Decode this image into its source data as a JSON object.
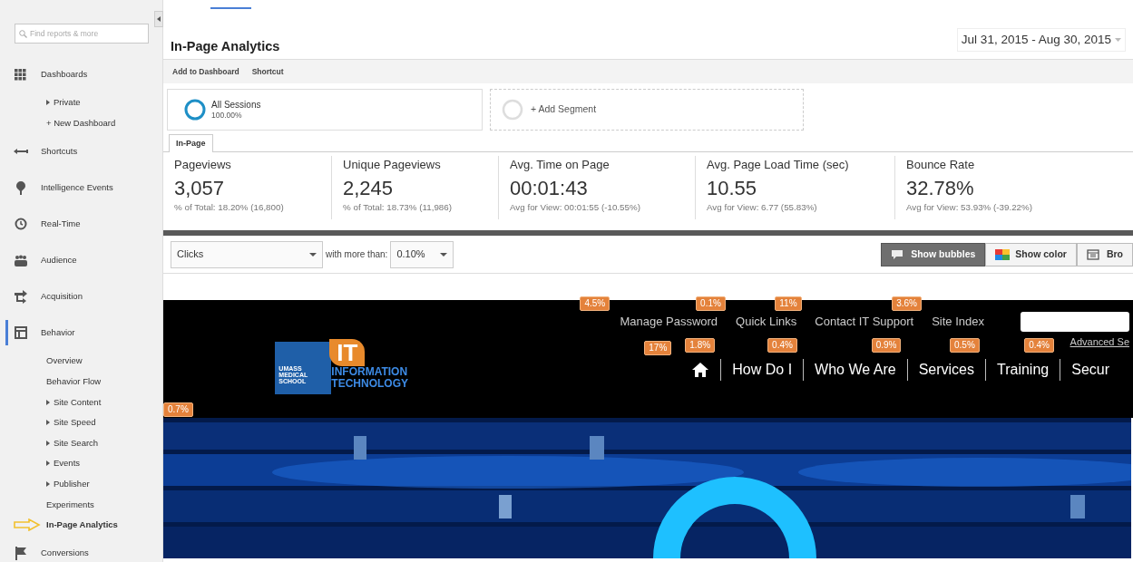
{
  "sidebar": {
    "search": {
      "placeholder": "Find reports & more"
    },
    "items": [
      {
        "label": "Dashboards",
        "selected": false,
        "children": [
          {
            "label": "Private",
            "expandable": true,
            "selected": false
          },
          {
            "label": "+ New Dashboard",
            "expandable": false,
            "selected": false
          }
        ]
      },
      {
        "label": "Shortcuts",
        "selected": false
      },
      {
        "label": "Intelligence Events",
        "selected": false
      },
      {
        "label": "Real-Time",
        "selected": false
      },
      {
        "label": "Audience",
        "selected": false
      },
      {
        "label": "Acquisition",
        "selected": false
      },
      {
        "label": "Behavior",
        "selected": true,
        "children": [
          {
            "label": "Overview",
            "expandable": false,
            "selected": false
          },
          {
            "label": "Behavior Flow",
            "expandable": false,
            "selected": false
          },
          {
            "label": "Site Content",
            "expandable": true,
            "selected": false
          },
          {
            "label": "Site Speed",
            "expandable": true,
            "selected": false
          },
          {
            "label": "Site Search",
            "expandable": true,
            "selected": false
          },
          {
            "label": "Events",
            "expandable": true,
            "selected": false
          },
          {
            "label": "Publisher",
            "expandable": true,
            "selected": false
          },
          {
            "label": "Experiments",
            "expandable": false,
            "selected": false
          },
          {
            "label": "In-Page Analytics",
            "expandable": false,
            "selected": true
          }
        ]
      },
      {
        "label": "Conversions",
        "selected": false
      }
    ]
  },
  "header": {
    "title": "In-Page Analytics",
    "date_range": "Jul 31, 2015 - Aug 30, 2015",
    "actions": [
      "Add to Dashboard",
      "Shortcut"
    ]
  },
  "segments": [
    {
      "label": "All Sessions",
      "sub": "100.00%"
    }
  ],
  "add_segment": "+ Add Segment",
  "tabs": [
    {
      "label": "In-Page",
      "selected": true
    }
  ],
  "metrics": [
    {
      "label": "Pageviews",
      "value": "3,057",
      "sub": "% of Total: 18.20% (16,800)"
    },
    {
      "label": "Unique Pageviews",
      "value": "2,245",
      "sub": "% of Total: 18.73% (11,986)"
    },
    {
      "label": "Avg. Time on Page",
      "value": "00:01:43",
      "sub": "Avg for View: 00:01:55 (-10.55%)"
    },
    {
      "label": "Avg. Page Load Time (sec)",
      "value": "10.55",
      "sub": "Avg for View: 6.77 (55.83%)"
    },
    {
      "label": "Bounce Rate",
      "value": "32.78%",
      "sub": "Avg for View: 53.93% (-39.22%)"
    }
  ],
  "controls": {
    "metric": "Clicks",
    "threshold_label": "with more than:",
    "threshold": "0.10%",
    "buttons": [
      {
        "label": "Show bubbles",
        "selected": true
      },
      {
        "label": "Show color",
        "selected": false
      },
      {
        "label": "Bro",
        "selected": false
      }
    ]
  },
  "site": {
    "top_links": [
      {
        "label": "Manage Password",
        "pct": "4.5%"
      },
      {
        "label": "Quick Links",
        "pct": "0.1%"
      },
      {
        "label": "Contact IT Support",
        "pct": "11%"
      },
      {
        "label": "Site Index",
        "pct": "3.6%"
      }
    ],
    "advanced_search": "Advanced Se",
    "logo": {
      "badge": "IT",
      "line1": "INFORMATION",
      "line2": "TECHNOLOGY",
      "school": [
        "UMASS",
        "MEDICAL",
        "SCHOOL"
      ]
    },
    "nav": [
      {
        "kind": "home",
        "pct": "17%"
      },
      {
        "kind": "text",
        "label": "How Do I",
        "pct": "1.8%"
      },
      {
        "kind": "text",
        "label": "Who We Are",
        "pct": "0.4%"
      },
      {
        "kind": "text",
        "label": "Services",
        "pct": "0.9%"
      },
      {
        "kind": "text",
        "label": "Training",
        "pct": "0.5%"
      },
      {
        "kind": "text",
        "label": "Secur",
        "pct": "0.4%"
      }
    ],
    "hero_pct": "0.7%"
  }
}
